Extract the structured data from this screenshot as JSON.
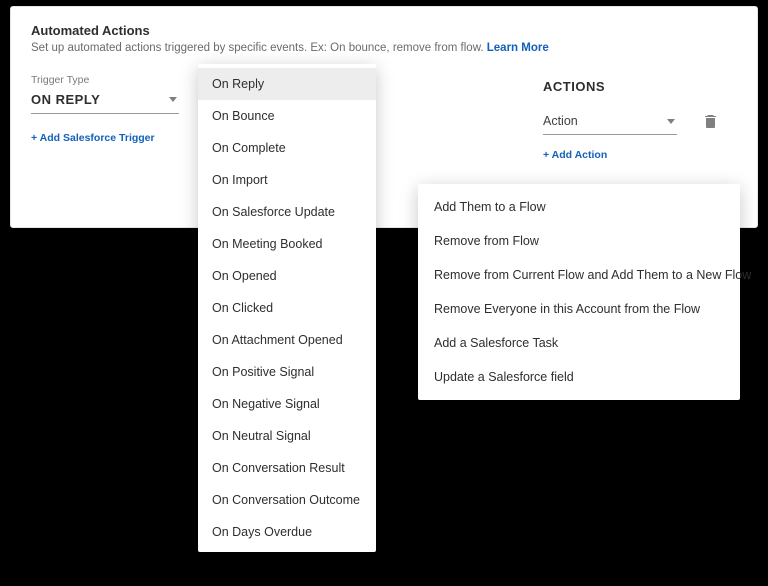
{
  "panel": {
    "title": "Automated Actions",
    "subtitle": "Set up automated actions triggered by specific events. Ex: On bounce, remove from flow. ",
    "learn_more": "Learn More"
  },
  "trigger": {
    "label": "Trigger Type",
    "value": "ON REPLY",
    "add_link": "+ Add Salesforce Trigger",
    "options": [
      "On Reply",
      "On Bounce",
      "On Complete",
      "On Import",
      "On Salesforce Update",
      "On Meeting Booked",
      "On Opened",
      "On Clicked",
      "On Attachment Opened",
      "On Positive Signal",
      "On Negative Signal",
      "On Neutral Signal",
      "On Conversation Result",
      "On Conversation Outcome",
      "On Days Overdue"
    ]
  },
  "actions": {
    "heading": "ACTIONS",
    "placeholder": "Action",
    "add_link": "+ Add Action",
    "options": [
      "Add Them to a Flow",
      "Remove from Flow",
      "Remove from Current Flow and Add Them to a New Flow",
      "Remove Everyone in this Account from the Flow",
      "Add a Salesforce Task",
      "Update a Salesforce field"
    ]
  }
}
